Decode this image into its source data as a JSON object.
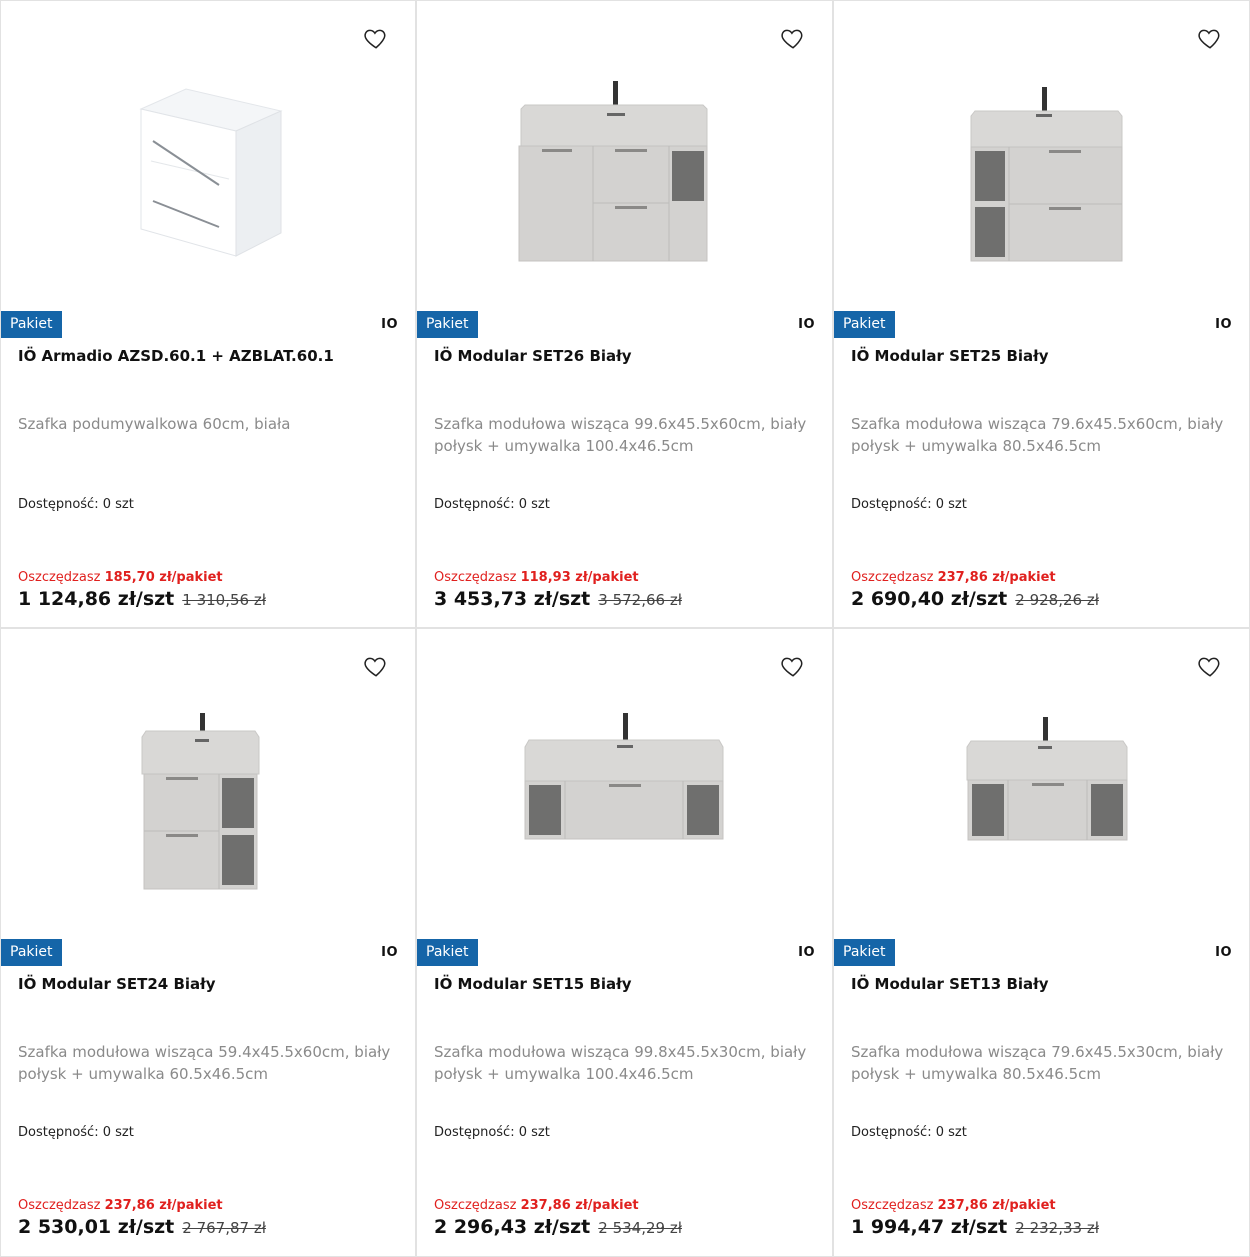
{
  "colors": {
    "badge": "#1565a8",
    "save": "#e0201e",
    "desc": "#8a8a8a"
  },
  "products": [
    {
      "badge": "Pakiet",
      "brand": "IO",
      "title": "IÖ Armadio AZSD.60.1 + AZBLAT.60.1",
      "desc": "Szafka podumywalkowa 60cm, biała",
      "availability": "Dostępność: 0 szt",
      "save_prefix": "Oszczędzasz",
      "save_amount": "185,70 zł/pakiet",
      "price": "1 124,86 zł/szt",
      "old_price": "1 310,56 zł",
      "image": "white-cabinet-icon"
    },
    {
      "badge": "Pakiet",
      "brand": "IO",
      "title": "IÖ Modular SET26 Biały",
      "desc": "Szafka modułowa wisząca 99.6x45.5x60cm, biały połysk + umywalka 100.4x46.5cm",
      "availability": "Dostępność: 0 szt",
      "save_prefix": "Oszczędzasz",
      "save_amount": "118,93 zł/pakiet",
      "price": "3 453,73 zł/szt",
      "old_price": "3 572,66 zł",
      "image": "vanity-unit-icon"
    },
    {
      "badge": "Pakiet",
      "brand": "IO",
      "title": "IÖ Modular SET25 Biały",
      "desc": "Szafka modułowa wisząca 79.6x45.5x60cm, biały połysk + umywalka 80.5x46.5cm",
      "availability": "Dostępność: 0 szt",
      "save_prefix": "Oszczędzasz",
      "save_amount": "237,86 zł/pakiet",
      "price": "2 690,40 zł/szt",
      "old_price": "2 928,26 zł",
      "image": "vanity-unit-icon"
    },
    {
      "badge": "Pakiet",
      "brand": "IO",
      "title": "IÖ Modular SET24 Biały",
      "desc": "Szafka modułowa wisząca 59.4x45.5x60cm, biały połysk + umywalka 60.5x46.5cm",
      "availability": "Dostępność: 0 szt",
      "save_prefix": "Oszczędzasz",
      "save_amount": "237,86 zł/pakiet",
      "price": "2 530,01 zł/szt",
      "old_price": "2 767,87 zł",
      "image": "vanity-unit-icon"
    },
    {
      "badge": "Pakiet",
      "brand": "IO",
      "title": "IÖ Modular SET15 Biały",
      "desc": "Szafka modułowa wisząca 99.8x45.5x30cm, biały połysk + umywalka 100.4x46.5cm",
      "availability": "Dostępność: 0 szt",
      "save_prefix": "Oszczędzasz",
      "save_amount": "237,86 zł/pakiet",
      "price": "2 296,43 zł/szt",
      "old_price": "2 534,29 zł",
      "image": "vanity-unit-icon"
    },
    {
      "badge": "Pakiet",
      "brand": "IO",
      "title": "IÖ Modular SET13 Biały",
      "desc": "Szafka modułowa wisząca 79.6x45.5x30cm, biały połysk + umywalka 80.5x46.5cm",
      "availability": "Dostępność: 0 szt",
      "save_prefix": "Oszczędzasz",
      "save_amount": "237,86 zł/pakiet",
      "price": "1 994,47 zł/szt",
      "old_price": "2 232,33 zł",
      "image": "vanity-unit-icon"
    }
  ]
}
